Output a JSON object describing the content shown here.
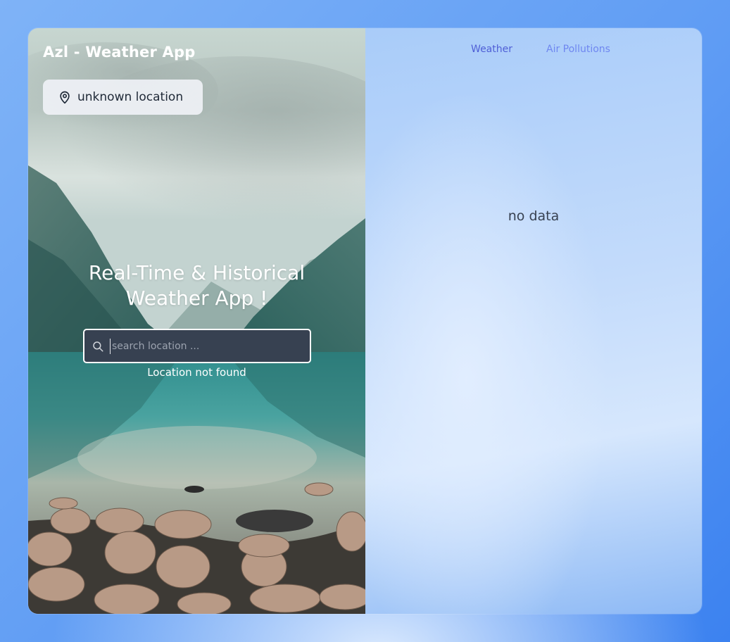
{
  "app": {
    "brand": "Azl - Weather App"
  },
  "location": {
    "label": "unknown location",
    "icon": "map-pin-icon"
  },
  "hero": {
    "line1": "Real-Time & Historical",
    "line2": "Weather App !"
  },
  "search": {
    "placeholder": "search location ...",
    "value": "",
    "icon": "search-icon",
    "error": "Location not found"
  },
  "tabs": [
    {
      "label": "Weather",
      "active": true
    },
    {
      "label": "Air Pollutions",
      "active": false
    }
  ],
  "content": {
    "empty_message": "no data"
  },
  "colors": {
    "accent": "#4f5fd6",
    "accent_light": "#6f87f0",
    "search_bg": "#374151"
  }
}
